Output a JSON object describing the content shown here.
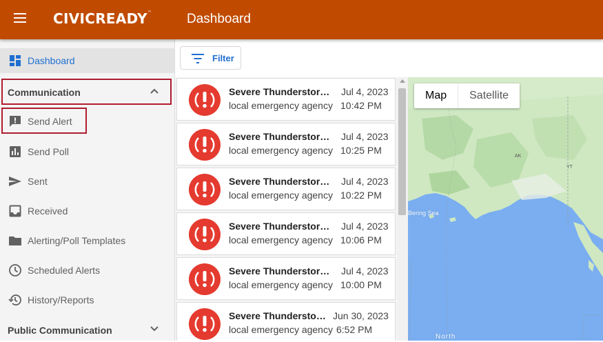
{
  "header": {
    "brand": "CIVICREADY",
    "brand_mark": "™",
    "title": "Dashboard"
  },
  "sidebar": {
    "dashboard": {
      "label": "Dashboard",
      "icon": "dashboard-icon"
    },
    "sections": [
      {
        "title": "Communication",
        "expanded": true,
        "items": [
          {
            "label": "Send Alert",
            "icon": "alert-message-icon"
          },
          {
            "label": "Send Poll",
            "icon": "poll-chart-icon"
          },
          {
            "label": "Sent",
            "icon": "send-icon"
          },
          {
            "label": "Received",
            "icon": "inbox-icon"
          },
          {
            "label": "Alerting/Poll Templates",
            "icon": "folder-icon"
          },
          {
            "label": "Scheduled Alerts",
            "icon": "clock-icon"
          },
          {
            "label": "History/Reports",
            "icon": "history-icon"
          }
        ]
      },
      {
        "title": "Public Communication",
        "expanded": false
      }
    ]
  },
  "toolbar": {
    "filter_label": "Filter"
  },
  "alerts": [
    {
      "title": "Severe Thunderstorm ...",
      "date": "Jul 4, 2023",
      "agency": "local emergency agency",
      "time": "10:42 PM"
    },
    {
      "title": "Severe Thunderstorm ...",
      "date": "Jul 4, 2023",
      "agency": "local emergency agency",
      "time": "10:25 PM"
    },
    {
      "title": "Severe Thunderstorm ...",
      "date": "Jul 4, 2023",
      "agency": "local emergency agency",
      "time": "10:22 PM"
    },
    {
      "title": "Severe Thunderstorm ...",
      "date": "Jul 4, 2023",
      "agency": "local emergency agency",
      "time": "10:06 PM"
    },
    {
      "title": "Severe Thunderstorm ...",
      "date": "Jul 4, 2023",
      "agency": "local emergency agency",
      "time": "10:00 PM"
    },
    {
      "title": "Severe Thunderstor...",
      "date": "Jun 30, 2023",
      "agency": "local emergency agency",
      "time": "6:52 PM"
    }
  ],
  "map": {
    "type_map": "Map",
    "type_satellite": "Satellite",
    "labels": {
      "sea": "Bering Sea",
      "ak": "AK",
      "yt": "YT",
      "north": "North"
    }
  },
  "colors": {
    "header": "#c04b00",
    "accent": "#1f6fd0",
    "alert": "#e53a2f",
    "highlight": "#b01b2e",
    "water": "#7aaef0",
    "land": "#cfe8c2"
  }
}
